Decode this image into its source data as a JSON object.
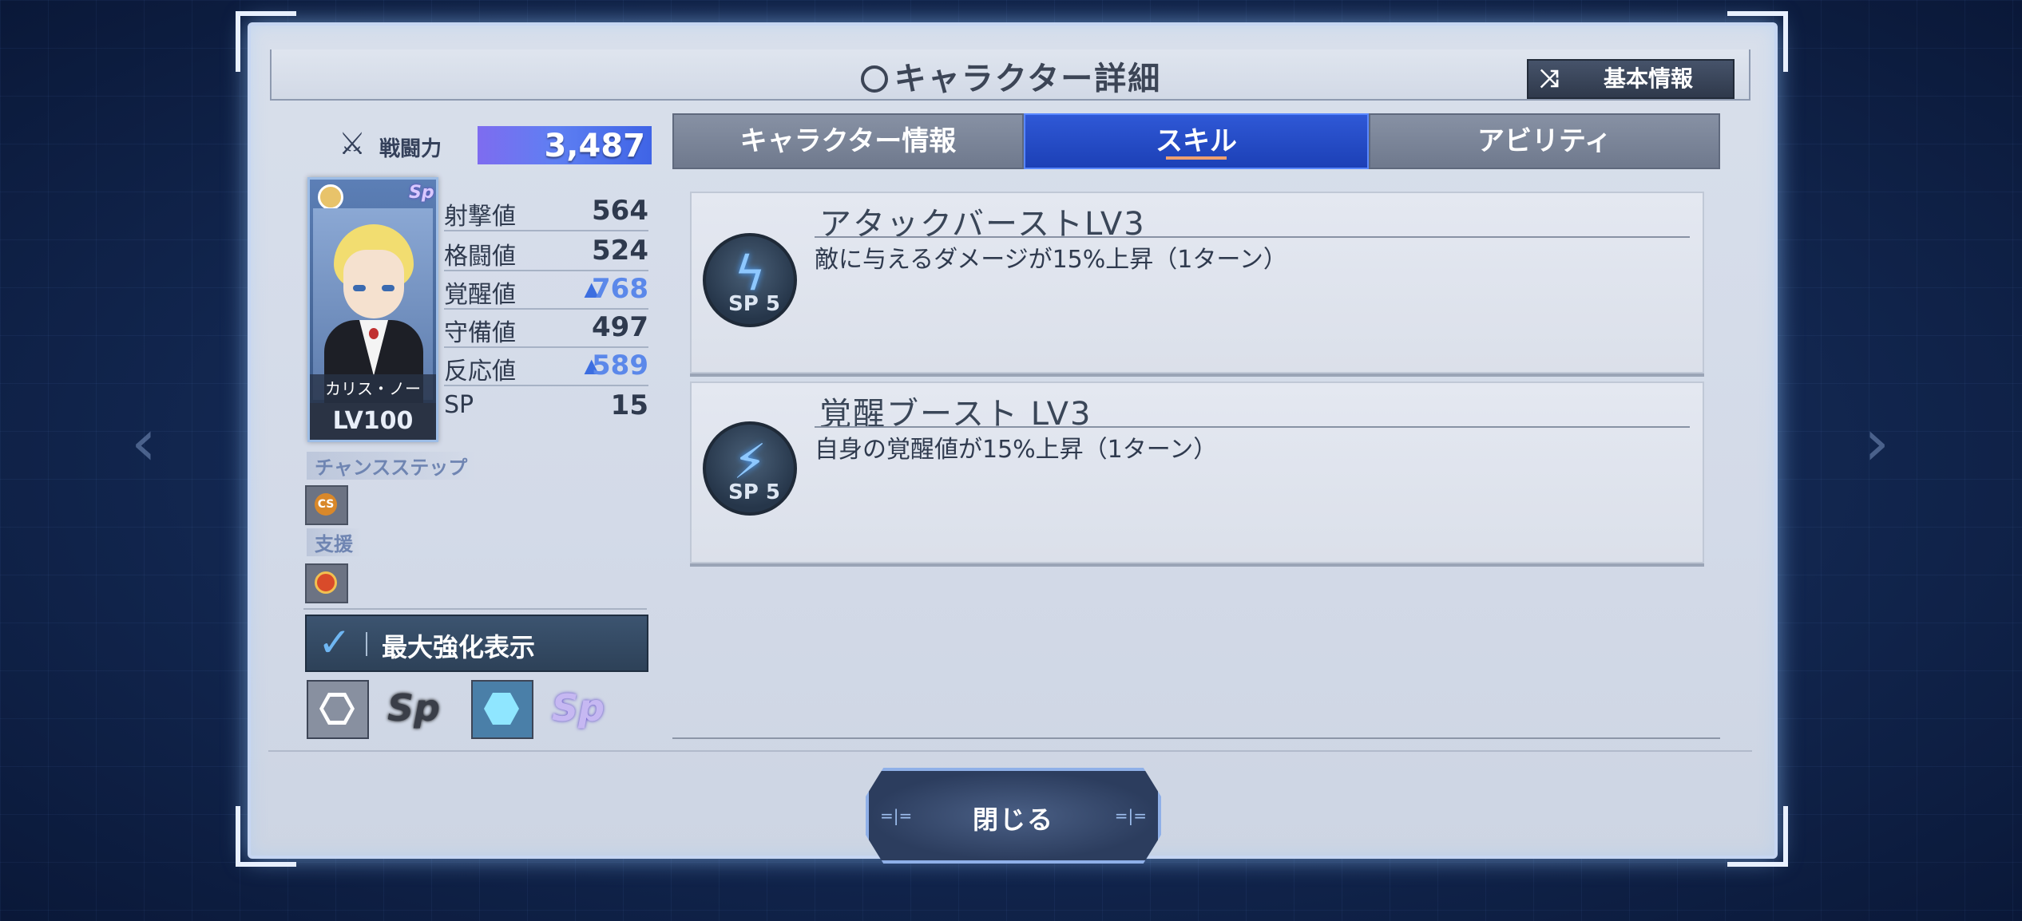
{
  "window": {
    "title": "キャラクター詳細",
    "toggle_button_label": "基本情報"
  },
  "character": {
    "power_label": "戦闘力",
    "power_value": "3,487",
    "name": "カリス・ノー",
    "level": "LV100",
    "badge": "Sp",
    "stats": [
      {
        "name": "射撃値",
        "value": "564",
        "boosted": false
      },
      {
        "name": "格闘値",
        "value": "524",
        "boosted": false
      },
      {
        "name": "覚醒値",
        "value": "768",
        "boosted": true
      },
      {
        "name": "守備値",
        "value": "497",
        "boosted": false
      },
      {
        "name": "反応値",
        "value": "589",
        "boosted": true
      },
      {
        "name": "SP",
        "value": "15",
        "boosted": false
      }
    ],
    "chance_step_label": "チャンスステップ",
    "chance_step_icon_text": "CS",
    "support_label": "支援",
    "max_enhance_label": "最大強化表示",
    "max_enhance_checked": true
  },
  "tabs": [
    {
      "label": "キャラクター情報",
      "active": false
    },
    {
      "label": "スキル",
      "active": true
    },
    {
      "label": "アビリティ",
      "active": false
    }
  ],
  "skills": [
    {
      "name": "アタックバーストLV3",
      "description": "敵に与えるダメージが15%上昇（1ターン）",
      "sp_cost": "SP 5",
      "icon": "lightning-burst-icon"
    },
    {
      "name": "覚醒ブースト LV3",
      "description": "自身の覚醒値が15%上昇（1ターン）",
      "sp_cost": "SP 5",
      "icon": "awakening-boost-icon"
    }
  ],
  "footer": {
    "close_label": "閉じる"
  },
  "colors": {
    "accent_blue": "#2f58d6",
    "boost_blue": "#5b88ea",
    "panel_bg": "#d8dfeb"
  }
}
